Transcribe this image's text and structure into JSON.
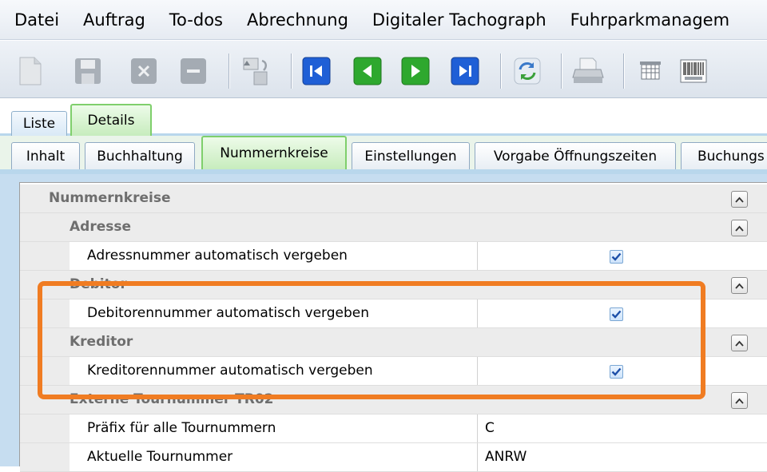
{
  "menu": {
    "items": [
      "Datei",
      "Auftrag",
      "To-dos",
      "Abrechnung",
      "Digitaler Tachograph",
      "Fuhrparkmanagem"
    ]
  },
  "toolbar": {
    "icons": [
      "new-icon",
      "save-icon",
      "delete-icon",
      "minus-icon",
      "copy-icon",
      "first-record-icon",
      "previous-record-icon",
      "next-record-icon",
      "last-record-icon",
      "refresh-icon",
      "print-icon",
      "grid-icon",
      "barcode-icon"
    ],
    "colors": {
      "nav_blue": "#1f5fd6",
      "nav_green": "#2ea82e",
      "disabled_gray": "#9aa3ad"
    }
  },
  "tabs_top": {
    "liste": "Liste",
    "details": "Details"
  },
  "tabs_second": {
    "inhalt": "Inhalt",
    "buchhaltung": "Buchhaltung",
    "nummernkreise": "Nummernkreise",
    "einstellungen": "Einstellungen",
    "vorgabe": "Vorgabe Öffnungszeiten",
    "buchungs": "Buchungs"
  },
  "grid": {
    "section_nummernkreise": "Nummernkreise",
    "adresse": {
      "title": "Adresse",
      "prop_label": "Adressnummer automatisch vergeben",
      "checked": true
    },
    "debitor": {
      "title": "Debitor",
      "prop_label": "Debitorennummer automatisch vergeben",
      "checked": true
    },
    "kreditor": {
      "title": "Kreditor",
      "prop_label": "Kreditorennummer automatisch vergeben",
      "checked": true
    },
    "extern": {
      "title": "Externe Tournummer TR02",
      "praefix_label": "Präfix für alle Tournummern",
      "praefix_value": "C",
      "aktuelle_label": "Aktuelle Tournummer",
      "aktuelle_value": "ANRW"
    }
  },
  "highlight_color": "#f07c22"
}
